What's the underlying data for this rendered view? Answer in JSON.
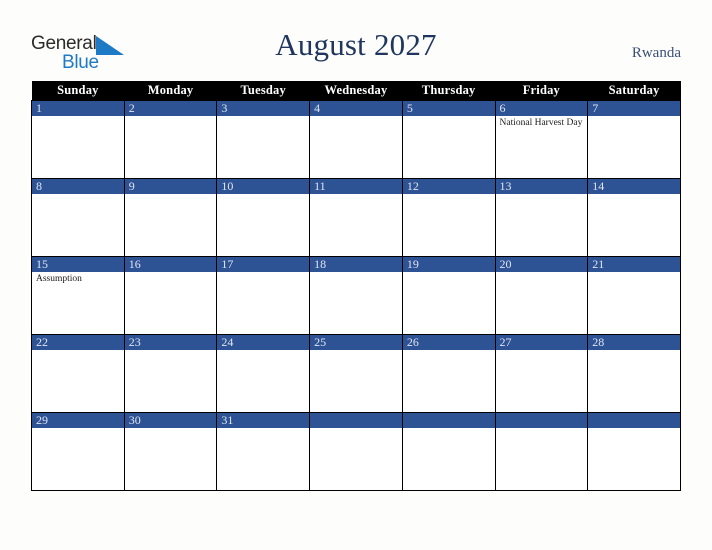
{
  "logo": {
    "word_top": "General",
    "word_bottom": "Blue",
    "triangle_color": "#1e7ac4",
    "top_color": "#2b2b2b"
  },
  "header": {
    "title": "August 2027",
    "country": "Rwanda",
    "title_color": "#20365e"
  },
  "calendar": {
    "weekday_headers": [
      "Sunday",
      "Monday",
      "Tuesday",
      "Wednesday",
      "Thursday",
      "Friday",
      "Saturday"
    ],
    "header_bg": "#000000",
    "date_bar_bg": "#2e5395",
    "date_text_color": "#dfe5f1",
    "weeks": [
      [
        {
          "date": "1",
          "events": []
        },
        {
          "date": "2",
          "events": []
        },
        {
          "date": "3",
          "events": []
        },
        {
          "date": "4",
          "events": []
        },
        {
          "date": "5",
          "events": []
        },
        {
          "date": "6",
          "events": [
            "National Harvest Day"
          ]
        },
        {
          "date": "7",
          "events": []
        }
      ],
      [
        {
          "date": "8",
          "events": []
        },
        {
          "date": "9",
          "events": []
        },
        {
          "date": "10",
          "events": []
        },
        {
          "date": "11",
          "events": []
        },
        {
          "date": "12",
          "events": []
        },
        {
          "date": "13",
          "events": []
        },
        {
          "date": "14",
          "events": []
        }
      ],
      [
        {
          "date": "15",
          "events": [
            "Assumption"
          ]
        },
        {
          "date": "16",
          "events": []
        },
        {
          "date": "17",
          "events": []
        },
        {
          "date": "18",
          "events": []
        },
        {
          "date": "19",
          "events": []
        },
        {
          "date": "20",
          "events": []
        },
        {
          "date": "21",
          "events": []
        }
      ],
      [
        {
          "date": "22",
          "events": []
        },
        {
          "date": "23",
          "events": []
        },
        {
          "date": "24",
          "events": []
        },
        {
          "date": "25",
          "events": []
        },
        {
          "date": "26",
          "events": []
        },
        {
          "date": "27",
          "events": []
        },
        {
          "date": "28",
          "events": []
        }
      ],
      [
        {
          "date": "29",
          "events": []
        },
        {
          "date": "30",
          "events": []
        },
        {
          "date": "31",
          "events": []
        },
        {
          "date": "",
          "events": []
        },
        {
          "date": "",
          "events": []
        },
        {
          "date": "",
          "events": []
        },
        {
          "date": "",
          "events": []
        }
      ]
    ]
  }
}
